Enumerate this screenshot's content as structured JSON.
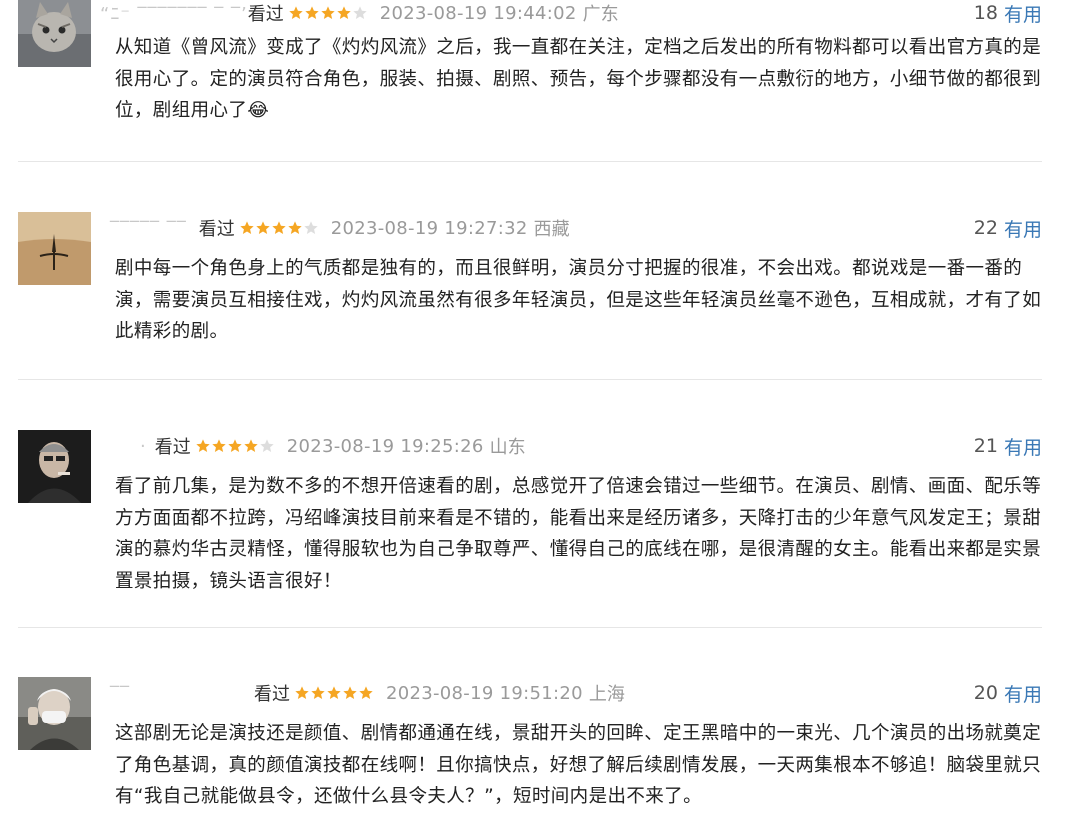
{
  "colors": {
    "star_on": "#f5a623",
    "star_off": "#dddddd",
    "useful_link": "#3a78b5",
    "meta_gray": "#9a9a9a"
  },
  "reviews": [
    {
      "username": "“ﾆ⁻   ‾‾‾‾‾‾‾  ‾ ‾’",
      "status": "看过",
      "rating": 4,
      "time": "2023-08-19 19:44:02",
      "location": "广东",
      "useful_count": "18",
      "useful_label": "有用",
      "content": "从知道《曾风流》变成了《灼灼风流》之后，我一直都在关注，定档之后发出的所有物料都可以看出官方真的是很用心了。定的演员符合角色，服装、拍摄、剧照、预告，每个步骤都没有一点敷衍的地方，小细节做的都很到位，剧组用心了😂",
      "avatar_icon": "cat-avatar-icon"
    },
    {
      "username": "‾‾‾‾‾ ‾‾",
      "status": "看过",
      "rating": 4,
      "time": "2023-08-19 19:27:32",
      "location": "西藏",
      "useful_count": "22",
      "useful_label": "有用",
      "content": "剧中每一个角色身上的气质都是独有的，而且很鲜明，演员分寸把握的很准，不会出戏。都说戏是一番一番的演，需要演员互相接住戏，灼灼风流虽然有很多年轻演员，但是这些年轻演员丝毫不逊色，互相成就，才有了如此精彩的剧。",
      "avatar_icon": "desert-avatar-icon"
    },
    {
      "username": "   ·",
      "status": "看过",
      "rating": 4,
      "time": "2023-08-19 19:25:26",
      "location": "山东",
      "useful_count": "21",
      "useful_label": "有用",
      "content": "看了前几集，是为数不多的不想开倍速看的剧，总感觉开了倍速会错过一些细节。在演员、剧情、画面、配乐等方方面面都不拉跨，冯绍峰演技目前来看是不错的，能看出来是经历诸多，天降打击的少年意气风发定王；景甜演的慕灼华古灵精怪，懂得服软也为自己争取尊严、懂得自己的底线在哪，是很清醒的女主。能看出来都是实景置景拍摄，镜头语言很好！",
      "avatar_icon": "portrait-avatar-icon"
    },
    {
      "username": "‾‾",
      "status": "看过",
      "rating": 5,
      "time": "2023-08-19 19:51:20",
      "location": "上海",
      "useful_count": "20",
      "useful_label": "有用",
      "content": "这部剧无论是演技还是颜值、剧情都通通在线，景甜开头的回眸、定王黑暗中的一束光、几个演员的出场就奠定了角色基调，真的颜值演技都在线啊！且你搞快点，好想了解后续剧情发展，一天两集根本不够追！脑袋里就只有“我自己就能做县令，还做什么县令夫人？”，短时间内是出不来了。",
      "avatar_icon": "masked-person-avatar-icon"
    }
  ]
}
